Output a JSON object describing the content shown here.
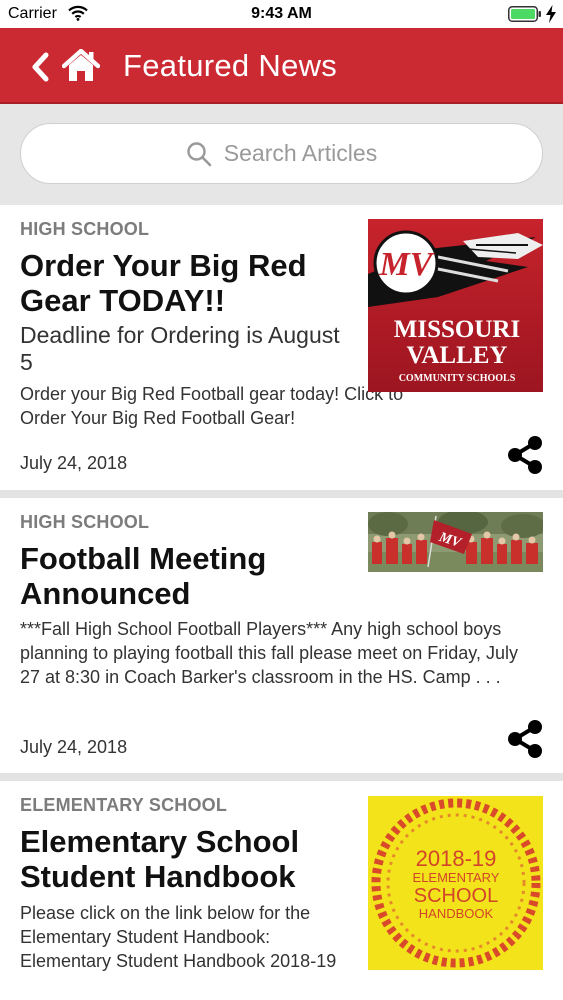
{
  "status_bar": {
    "carrier": "Carrier",
    "time": "9:43 AM"
  },
  "nav": {
    "title": "Featured News",
    "back_icon": "chevron-left-icon",
    "home_icon": "home-icon"
  },
  "search": {
    "placeholder": "Search Articles"
  },
  "articles": [
    {
      "category": "HIGH SCHOOL",
      "title": "Order Your Big Red Gear TODAY!!",
      "subtitle": "Deadline for Ordering is August 5",
      "summary": "Order your Big Red Football gear today! Click to Order Your Big Red Football Gear!",
      "date": "July 24, 2018",
      "image": {
        "logo_letters": "MV",
        "line1": "MISSOURI",
        "line2": "VALLEY",
        "line3": "COMMUNITY SCHOOLS"
      }
    },
    {
      "category": "HIGH SCHOOL",
      "title": "Football Meeting Announced",
      "summary": "***Fall High School Football Players*** Any high school boys planning to playing football this fall please meet on Friday, July 27 at 8:30 in Coach Barker's classroom in the HS. Camp . . .",
      "date": "July 24, 2018",
      "image": {
        "flag_letters": "MV"
      }
    },
    {
      "category": "ELEMENTARY SCHOOL",
      "title": "Elementary School Student Handbook",
      "summary": "Please click on the link below for the Elementary Student Handbook: Elementary Student Handbook 2018-19",
      "image": {
        "line1": "2018-19",
        "line2": "ELEMENTARY",
        "line3": "SCHOOL",
        "line4": "HANDBOOK"
      }
    }
  ],
  "colors": {
    "brand_red": "#cc2a33",
    "background_gray": "#e6e6e6",
    "battery_green": "#4cd964"
  }
}
